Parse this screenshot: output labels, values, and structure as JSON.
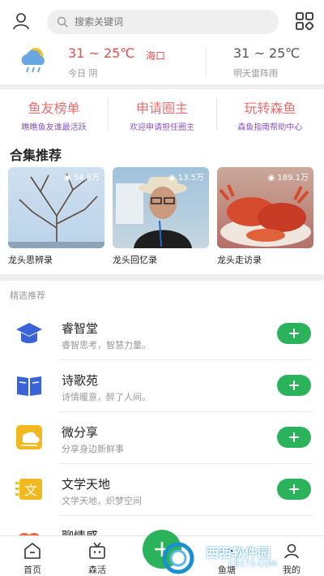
{
  "header": {
    "search_placeholder": "搜索关键词",
    "icons": [
      "user-icon",
      "search-icon",
      "grid-icon"
    ]
  },
  "weather": {
    "today_temp": "31 ~ 25℃",
    "city": "海口",
    "today_label": "今日 阴",
    "tomorrow_temp": "31 ~ 25℃",
    "tomorrow_label": "明天雷阵雨"
  },
  "quick_links": [
    {
      "title": "鱼友榜单",
      "subtitle": "瞧瞧鱼友谁最活跃"
    },
    {
      "title": "申请圈主",
      "subtitle": "欢迎申请担任圈主"
    },
    {
      "title": "玩转森鱼",
      "subtitle": "森鱼指南帮助中心"
    }
  ],
  "collections": {
    "title": "合集推荐",
    "items": [
      {
        "label": "龙头思辨录",
        "views": "54.8万"
      },
      {
        "label": "龙头回忆录",
        "views": "13.5万"
      },
      {
        "label": "龙头走访录",
        "views": "189.1万"
      }
    ]
  },
  "featured": {
    "title": "精选推荐",
    "items": [
      {
        "title": "睿智堂",
        "subtitle": "睿智思考，智慧力量。",
        "icon": "graduation-cap-icon",
        "color": "#3a63d8"
      },
      {
        "title": "诗歌苑",
        "subtitle": "诗情暖意，醉了人间。",
        "icon": "book-icon",
        "color": "#3a63d8"
      },
      {
        "title": "微分享",
        "subtitle": "分享身边新鲜事",
        "icon": "share-icon",
        "color": "#f2b820"
      },
      {
        "title": "文学天地",
        "subtitle": "文学天地，织梦空间",
        "icon": "literature-icon",
        "color": "#f2b820"
      },
      {
        "title": "聊情感",
        "subtitle": "",
        "icon": "heart-icon",
        "color": "#ee6a3a"
      }
    ]
  },
  "tabbar": {
    "home": "首页",
    "life": "森活",
    "pond": "鱼塘",
    "mine": "我的"
  },
  "watermark": {
    "text": "西西软件园",
    "url": "CR173.COM"
  },
  "colors": {
    "accent_green": "#2bb35c",
    "link_red": "#e76f6f",
    "link_purple": "#8a56c2"
  }
}
